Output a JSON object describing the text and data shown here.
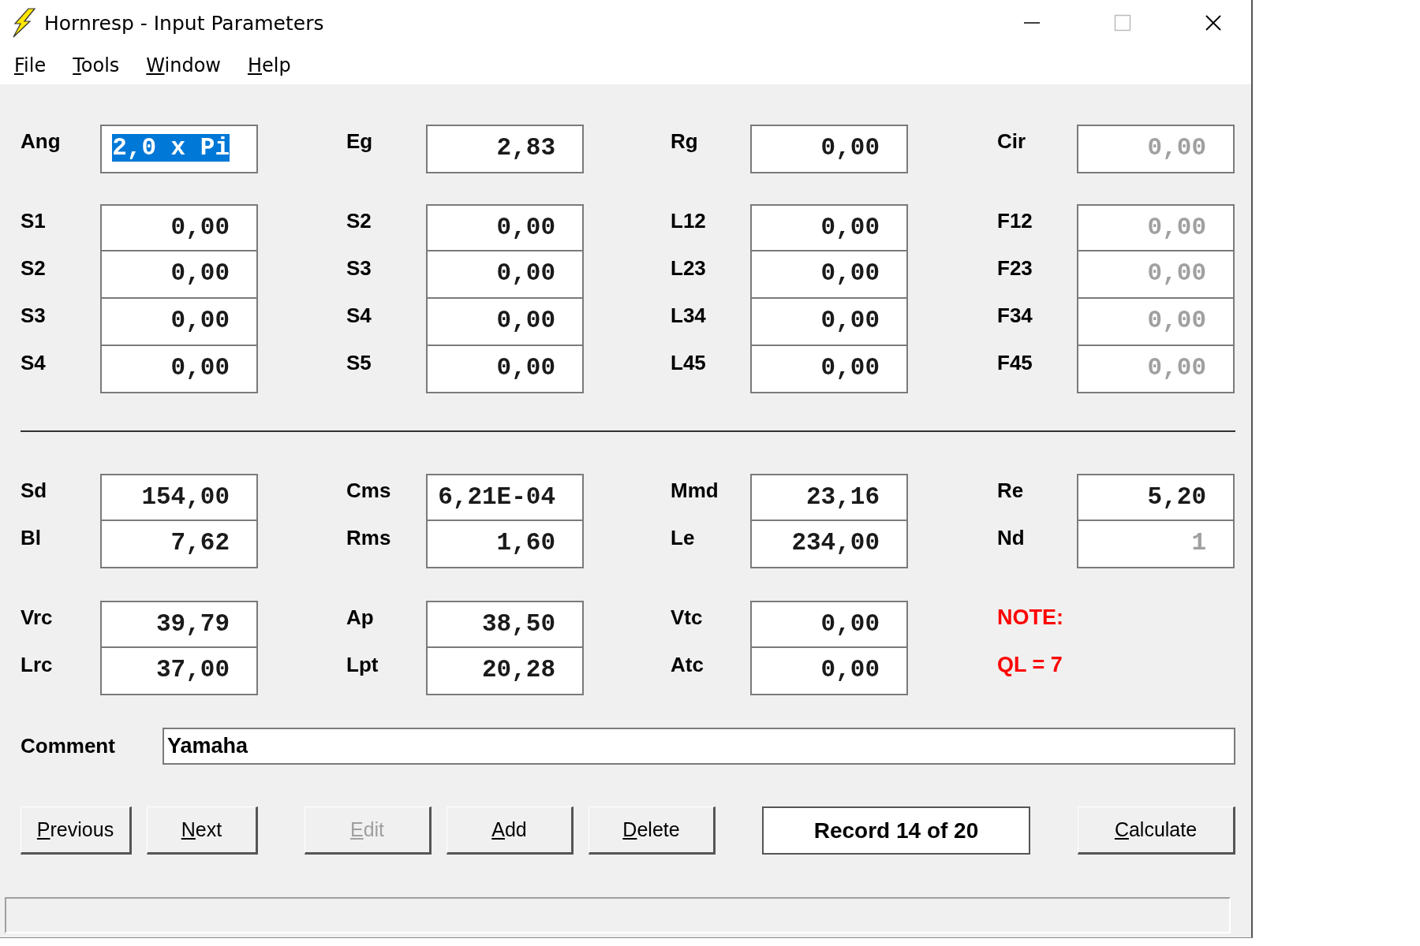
{
  "window": {
    "title": "Hornresp - Input Parameters"
  },
  "menu": [
    {
      "label": "File"
    },
    {
      "label": "Tools"
    },
    {
      "label": "Window"
    },
    {
      "label": "Help"
    }
  ],
  "horn_groups": [
    {
      "rows": [
        [
          {
            "kind": "field",
            "label": "Ang",
            "value": "2,0 x Pi",
            "disabled": false,
            "text_selected": true
          },
          {
            "kind": "field",
            "label": "Eg",
            "value": "2,83",
            "disabled": false,
            "text_selected": false
          },
          {
            "kind": "field",
            "label": "Rg",
            "value": "0,00",
            "disabled": false,
            "text_selected": false
          },
          {
            "kind": "field",
            "label": "Cir",
            "value": "0,00",
            "disabled": true,
            "text_selected": false
          }
        ]
      ]
    },
    {
      "rows": [
        [
          {
            "kind": "field",
            "label": "S1",
            "value": "0,00",
            "disabled": false,
            "text_selected": false
          },
          {
            "kind": "field",
            "label": "S2",
            "value": "0,00",
            "disabled": false,
            "text_selected": false
          },
          {
            "kind": "field",
            "label": "L12",
            "value": "0,00",
            "disabled": false,
            "text_selected": false
          },
          {
            "kind": "field",
            "label": "F12",
            "value": "0,00",
            "disabled": true,
            "text_selected": false
          }
        ],
        [
          {
            "kind": "field",
            "label": "S2",
            "value": "0,00",
            "disabled": false,
            "text_selected": false
          },
          {
            "kind": "field",
            "label": "S3",
            "value": "0,00",
            "disabled": false,
            "text_selected": false
          },
          {
            "kind": "field",
            "label": "L23",
            "value": "0,00",
            "disabled": false,
            "text_selected": false
          },
          {
            "kind": "field",
            "label": "F23",
            "value": "0,00",
            "disabled": true,
            "text_selected": false
          }
        ],
        [
          {
            "kind": "field",
            "label": "S3",
            "value": "0,00",
            "disabled": false,
            "text_selected": false
          },
          {
            "kind": "field",
            "label": "S4",
            "value": "0,00",
            "disabled": false,
            "text_selected": false
          },
          {
            "kind": "field",
            "label": "L34",
            "value": "0,00",
            "disabled": false,
            "text_selected": false
          },
          {
            "kind": "field",
            "label": "F34",
            "value": "0,00",
            "disabled": true,
            "text_selected": false
          }
        ],
        [
          {
            "kind": "field",
            "label": "S4",
            "value": "0,00",
            "disabled": false,
            "text_selected": false
          },
          {
            "kind": "field",
            "label": "S5",
            "value": "0,00",
            "disabled": false,
            "text_selected": false
          },
          {
            "kind": "field",
            "label": "L45",
            "value": "0,00",
            "disabled": false,
            "text_selected": false
          },
          {
            "kind": "field",
            "label": "F45",
            "value": "0,00",
            "disabled": true,
            "text_selected": false
          }
        ]
      ]
    }
  ],
  "driver_groups": [
    {
      "rows": [
        [
          {
            "kind": "field",
            "label": "Sd",
            "value": "154,00",
            "disabled": false,
            "text_selected": false
          },
          {
            "kind": "field",
            "label": "Cms",
            "value": "6,21E-04",
            "disabled": false,
            "text_selected": false
          },
          {
            "kind": "field",
            "label": "Mmd",
            "value": "23,16",
            "disabled": false,
            "text_selected": false
          },
          {
            "kind": "field",
            "label": "Re",
            "value": "5,20",
            "disabled": false,
            "text_selected": false
          }
        ],
        [
          {
            "kind": "field",
            "label": "Bl",
            "value": "7,62",
            "disabled": false,
            "text_selected": false
          },
          {
            "kind": "field",
            "label": "Rms",
            "value": "1,60",
            "disabled": false,
            "text_selected": false
          },
          {
            "kind": "field",
            "label": "Le",
            "value": "234,00",
            "disabled": false,
            "text_selected": false
          },
          {
            "kind": "field",
            "label": "Nd",
            "value": "1",
            "disabled": true,
            "text_selected": false
          }
        ]
      ]
    },
    {
      "rows": [
        [
          {
            "kind": "field",
            "label": "Vrc",
            "value": "39,79",
            "disabled": false,
            "text_selected": false
          },
          {
            "kind": "field",
            "label": "Ap",
            "value": "38,50",
            "disabled": false,
            "text_selected": false
          },
          {
            "kind": "field",
            "label": "Vtc",
            "value": "0,00",
            "disabled": false,
            "text_selected": false
          },
          {
            "kind": "note",
            "text": "NOTE:"
          }
        ],
        [
          {
            "kind": "field",
            "label": "Lrc",
            "value": "37,00",
            "disabled": false,
            "text_selected": false
          },
          {
            "kind": "field",
            "label": "Lpt",
            "value": "20,28",
            "disabled": false,
            "text_selected": false
          },
          {
            "kind": "field",
            "label": "Atc",
            "value": "0,00",
            "disabled": false,
            "text_selected": false
          },
          {
            "kind": "note",
            "text": "QL = 7"
          }
        ]
      ]
    }
  ],
  "comment": {
    "label": "Comment",
    "value": "Yamaha"
  },
  "buttons": [
    {
      "label": "Previous",
      "disabled": false
    },
    {
      "label": "Next",
      "disabled": false
    },
    {
      "label": "Edit",
      "disabled": true
    },
    {
      "label": "Add",
      "disabled": false
    },
    {
      "label": "Delete",
      "disabled": false
    }
  ],
  "record": "Record 14 of 20",
  "calculate": {
    "label": "Calculate",
    "disabled": false
  }
}
